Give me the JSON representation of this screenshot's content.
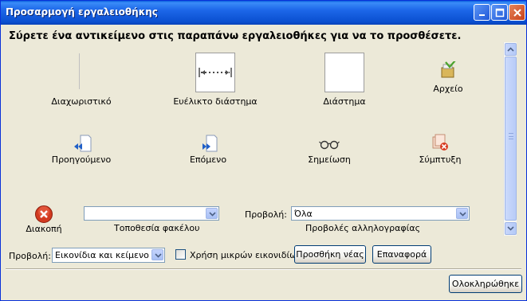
{
  "window": {
    "title": "Προσαρμογή εργαλειοθήκης"
  },
  "instruction": "Σύρετε ένα αντικείμενο στις παραπάνω εργαλειοθήκες για να το προσθέσετε.",
  "palette": {
    "items": [
      {
        "label": "Διαχωριστικό",
        "icon": "separator-icon"
      },
      {
        "label": "Ευέλικτο διάστημα",
        "icon": "flexible-space-icon"
      },
      {
        "label": "Διάστημα",
        "icon": "space-icon"
      },
      {
        "label": "Αρχείο",
        "icon": "archive-icon"
      },
      {
        "label": "Προηγούμενο",
        "icon": "previous-icon"
      },
      {
        "label": "Επόμενο",
        "icon": "next-icon"
      },
      {
        "label": "Σημείωση",
        "icon": "glasses-icon"
      },
      {
        "label": "Σύμπτυξη",
        "icon": "collapse-icon"
      },
      {
        "label": "Διακοπή",
        "icon": "stop-icon"
      }
    ],
    "folder_location": {
      "label": "Τοποθεσία φακέλου",
      "value": ""
    },
    "mail_views": {
      "prefix_label": "Προβολή:",
      "label": "Προβολές αλληλογραφίας",
      "value": "Όλα"
    }
  },
  "footer": {
    "view_label": "Προβολή:",
    "view_value": "Εικονίδια και κείμενο",
    "small_icons_label": "Χρήση μικρών εικονιδίων",
    "small_icons_checked": false,
    "add_new_label": "Προσθήκη νέας",
    "reset_label": "Επαναφορά",
    "done_label": "Ολοκληρώθηκε"
  },
  "colors": {
    "titlebar": "#0a4fd0",
    "dialog_bg": "#ece9d8",
    "button_border": "#003c74"
  }
}
